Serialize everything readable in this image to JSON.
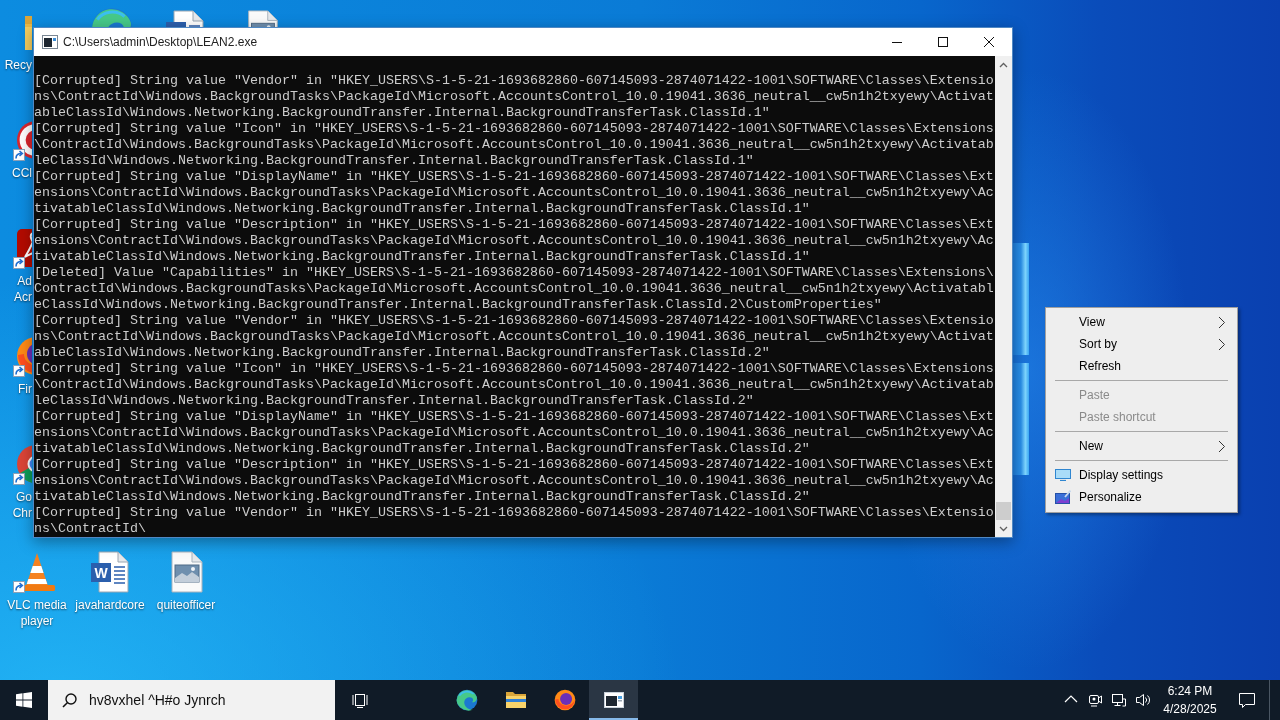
{
  "desktop": {
    "icons": [
      {
        "kind": "folder",
        "shortcut": false,
        "label": [
          "Recy"
        ]
      },
      {
        "kind": "edge"
      },
      {
        "kind": "word"
      },
      {
        "kind": "image"
      },
      {
        "kind": "cleaner",
        "shortcut": true,
        "label": [
          "CCl"
        ]
      },
      {
        "kind": "pdf",
        "shortcut": true,
        "label": [
          "Ad",
          "Acr"
        ]
      },
      {
        "kind": "firefox",
        "shortcut": true,
        "label": [
          "Fir"
        ]
      },
      {
        "kind": "chrome",
        "shortcut": true,
        "label": [
          "Go",
          "Chr"
        ]
      },
      {
        "kind": "vlc",
        "shortcut": true,
        "label": [
          "VLC media",
          "player"
        ]
      },
      {
        "kind": "word",
        "shortcut": false,
        "glyph": "W",
        "label": [
          "javahardcore"
        ]
      },
      {
        "kind": "image",
        "shortcut": false,
        "label": [
          "quiteofficer"
        ]
      }
    ]
  },
  "console_window": {
    "title": "C:\\Users\\admin\\Desktop\\LEAN2.exe",
    "lines": [
      "[Corrupted] String value \"Vendor\" in \"HKEY_USERS\\S-1-5-21-1693682860-607145093-2874071422-1001\\SOFTWARE\\Classes\\Extensio",
      "ns\\ContractId\\Windows.BackgroundTasks\\PackageId\\Microsoft.AccountsControl_10.0.19041.3636_neutral__cw5n1h2txyewy\\Activat",
      "ableClassId\\Windows.Networking.BackgroundTransfer.Internal.BackgroundTransferTask.ClassId.1\"",
      "[Corrupted] String value \"Icon\" in \"HKEY_USERS\\S-1-5-21-1693682860-607145093-2874071422-1001\\SOFTWARE\\Classes\\Extensions",
      "\\ContractId\\Windows.BackgroundTasks\\PackageId\\Microsoft.AccountsControl_10.0.19041.3636_neutral__cw5n1h2txyewy\\Activatab",
      "leClassId\\Windows.Networking.BackgroundTransfer.Internal.BackgroundTransferTask.ClassId.1\"",
      "[Corrupted] String value \"DisplayName\" in \"HKEY_USERS\\S-1-5-21-1693682860-607145093-2874071422-1001\\SOFTWARE\\Classes\\Ext",
      "ensions\\ContractId\\Windows.BackgroundTasks\\PackageId\\Microsoft.AccountsControl_10.0.19041.3636_neutral__cw5n1h2txyewy\\Ac",
      "tivatableClassId\\Windows.Networking.BackgroundTransfer.Internal.BackgroundTransferTask.ClassId.1\"",
      "[Corrupted] String value \"Description\" in \"HKEY_USERS\\S-1-5-21-1693682860-607145093-2874071422-1001\\SOFTWARE\\Classes\\Ext",
      "ensions\\ContractId\\Windows.BackgroundTasks\\PackageId\\Microsoft.AccountsControl_10.0.19041.3636_neutral__cw5n1h2txyewy\\Ac",
      "tivatableClassId\\Windows.Networking.BackgroundTransfer.Internal.BackgroundTransferTask.ClassId.1\"",
      "[Deleted] Value \"Capabilities\" in \"HKEY_USERS\\S-1-5-21-1693682860-607145093-2874071422-1001\\SOFTWARE\\Classes\\Extensions\\",
      "ContractId\\Windows.BackgroundTasks\\PackageId\\Microsoft.AccountsControl_10.0.19041.3636_neutral__cw5n1h2txyewy\\Activatabl",
      "eClassId\\Windows.Networking.BackgroundTransfer.Internal.BackgroundTransferTask.ClassId.2\\CustomProperties\"",
      "[Corrupted] String value \"Vendor\" in \"HKEY_USERS\\S-1-5-21-1693682860-607145093-2874071422-1001\\SOFTWARE\\Classes\\Extensio",
      "ns\\ContractId\\Windows.BackgroundTasks\\PackageId\\Microsoft.AccountsControl_10.0.19041.3636_neutral__cw5n1h2txyewy\\Activat",
      "ableClassId\\Windows.Networking.BackgroundTransfer.Internal.BackgroundTransferTask.ClassId.2\"",
      "[Corrupted] String value \"Icon\" in \"HKEY_USERS\\S-1-5-21-1693682860-607145093-2874071422-1001\\SOFTWARE\\Classes\\Extensions",
      "\\ContractId\\Windows.BackgroundTasks\\PackageId\\Microsoft.AccountsControl_10.0.19041.3636_neutral__cw5n1h2txyewy\\Activatab",
      "leClassId\\Windows.Networking.BackgroundTransfer.Internal.BackgroundTransferTask.ClassId.2\"",
      "[Corrupted] String value \"DisplayName\" in \"HKEY_USERS\\S-1-5-21-1693682860-607145093-2874071422-1001\\SOFTWARE\\Classes\\Ext",
      "ensions\\ContractId\\Windows.BackgroundTasks\\PackageId\\Microsoft.AccountsControl_10.0.19041.3636_neutral__cw5n1h2txyewy\\Ac",
      "tivatableClassId\\Windows.Networking.BackgroundTransfer.Internal.BackgroundTransferTask.ClassId.2\"",
      "[Corrupted] String value \"Description\" in \"HKEY_USERS\\S-1-5-21-1693682860-607145093-2874071422-1001\\SOFTWARE\\Classes\\Ext",
      "ensions\\ContractId\\Windows.BackgroundTasks\\PackageId\\Microsoft.AccountsControl_10.0.19041.3636_neutral__cw5n1h2txyewy\\Ac",
      "tivatableClassId\\Windows.Networking.BackgroundTransfer.Internal.BackgroundTransferTask.ClassId.2\"",
      "[Corrupted] String value \"Vendor\" in \"HKEY_USERS\\S-1-5-21-1693682860-607145093-2874071422-1001\\SOFTWARE\\Classes\\Extensio",
      "ns\\ContractId\\"
    ]
  },
  "context_menu": {
    "groups": [
      {
        "items": [
          {
            "label": "View",
            "kind": "text",
            "submenu": true,
            "disabled": false
          },
          {
            "label": "Sort by",
            "kind": "text",
            "submenu": true,
            "disabled": false
          },
          {
            "label": "Refresh",
            "kind": "text",
            "submenu": false,
            "disabled": false
          }
        ]
      },
      {
        "items": [
          {
            "label": "Paste",
            "kind": "text",
            "submenu": false,
            "disabled": true
          },
          {
            "label": "Paste shortcut",
            "kind": "text",
            "submenu": false,
            "disabled": true
          }
        ]
      },
      {
        "items": [
          {
            "label": "New",
            "kind": "text",
            "submenu": true,
            "disabled": false
          }
        ]
      },
      {
        "items": [
          {
            "label": "Display settings",
            "kind": "display",
            "submenu": false,
            "disabled": false
          },
          {
            "label": "Personalize",
            "kind": "personalize",
            "submenu": false,
            "disabled": false
          }
        ]
      }
    ]
  },
  "taskbar": {
    "search": {
      "value": "hv8vxhel ^H#o Jynrch"
    },
    "apps": [
      {
        "kind": "edge",
        "selected": false
      },
      {
        "kind": "explorer",
        "selected": false
      },
      {
        "kind": "firefox",
        "selected": false
      },
      {
        "kind": "console",
        "selected": true
      }
    ],
    "clock": {
      "time": "6:24 PM",
      "date": "4/28/2025"
    }
  }
}
